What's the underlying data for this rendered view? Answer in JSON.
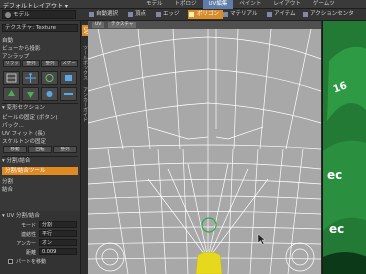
{
  "menubar": {
    "layout_label": "デフォルトレイアウト ▾",
    "tabs": [
      "モデル",
      "トポロジ",
      "UV編集",
      "ペイント",
      "レイアウト",
      "ゲームツ"
    ],
    "active_tab": 2
  },
  "toolbar": {
    "mode_value": "モデル",
    "auto_select": "自動選択",
    "vertex": "頂点",
    "edge": "エッジ",
    "polygon": "ポリゴン",
    "material": "マテリアル",
    "item": "アイテム",
    "action_center": "アクションセンタ"
  },
  "leftpanel": {
    "texture_field": "テクスチャ: Texture",
    "lines": [
      "自動",
      "ビューから投影",
      "アンラップ"
    ],
    "buttons": [
      "リラックス",
      "整列",
      "整列",
      "スケール"
    ],
    "section_deform": "▾ 変形セクション",
    "deform_lines": [
      "ピールの固定 (ボタン)",
      "パック...",
      "UV フィット (長)",
      "スケルトンの固定"
    ],
    "mini_buttons": [
      "移動",
      "回転",
      "整列"
    ],
    "section_split": "▾ 分割/結合",
    "split_combine_tool": "分割/結合ツール",
    "sub_items": [
      "分割",
      "結合"
    ],
    "props_section": "▾ UV 分割/結合",
    "props": [
      {
        "label": "モード",
        "value": "分割"
      },
      {
        "label": "連結性",
        "value": "平行"
      },
      {
        "label": "アンカー",
        "value": "オン"
      },
      {
        "label": "距離",
        "value": "0.009"
      }
    ],
    "part_move": "パートを移動"
  },
  "vstrip_labels": {
    "uv": "UV",
    "toolbox": "ツールボックス",
    "anchor": "アンカーガイド"
  },
  "viewport": {
    "header_btn1": "UV",
    "header_btn2": "テクスチャ"
  },
  "colors": {
    "accent_orange": "#d98d2a",
    "tab_blue": "#5f7da6",
    "uv_background": "#a5a5a5",
    "selection_yellow": "#e6d81c",
    "highlight_green": "#2fa84a"
  }
}
